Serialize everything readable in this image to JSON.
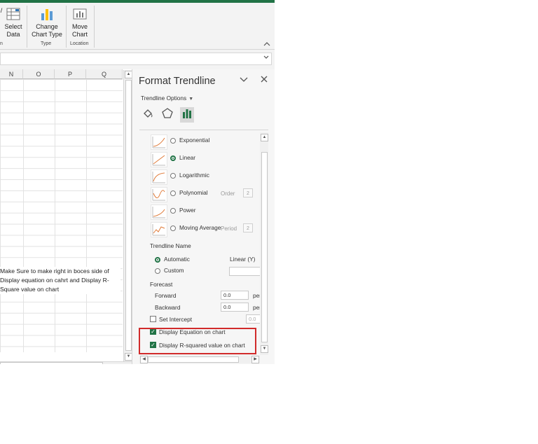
{
  "ribbon": {
    "select_data": "Select\nData",
    "select_data_l1": "Select",
    "select_data_l2": "Data",
    "change_chart_type_l1": "Change",
    "change_chart_type_l2": "Chart Type",
    "move_chart_l1": "Move",
    "move_chart_l2": "Chart",
    "group_type": "Type",
    "group_location": "Location",
    "left_cut_group_char": "n",
    "collapse_glyph": "^"
  },
  "sheet": {
    "columns": [
      "N",
      "O",
      "P",
      "Q"
    ],
    "note_line1": "Make Sure to make right in boces side of",
    "note_line2": "Display equation on cahrt and Display R-",
    "note_line3": "Square value on chart"
  },
  "pane": {
    "title": "Format Trendline",
    "options_label": "Trendline Options",
    "types": [
      {
        "label": "Exponential",
        "selected": false
      },
      {
        "label": "Linear",
        "selected": true
      },
      {
        "label": "Logarithmic",
        "selected": false
      },
      {
        "label": "Polynomial",
        "selected": false
      },
      {
        "label": "Power",
        "selected": false
      },
      {
        "label": "Moving Average",
        "selected": false
      }
    ],
    "order_label": "Order",
    "order_value": "2",
    "period_label": "Period",
    "period_value": "2",
    "trendline_name_label": "Trendline Name",
    "automatic_label": "Automatic",
    "automatic_value": "Linear (Y)",
    "custom_label": "Custom",
    "forecast_label": "Forecast",
    "forward_label": "Forward",
    "forward_value": "0.0",
    "forward_unit": "per",
    "backward_label": "Backward",
    "backward_value": "0.0",
    "backward_unit": "per",
    "set_intercept_label": "Set Intercept",
    "intercept_value": "0.0",
    "display_equation_label": "Display Equation on chart",
    "display_equation_checked": true,
    "display_rsquared_label": "Display R-squared value on chart",
    "display_rsquared_checked": true
  },
  "colors": {
    "excel_green": "#217346",
    "highlight_red": "#d12b2b"
  }
}
